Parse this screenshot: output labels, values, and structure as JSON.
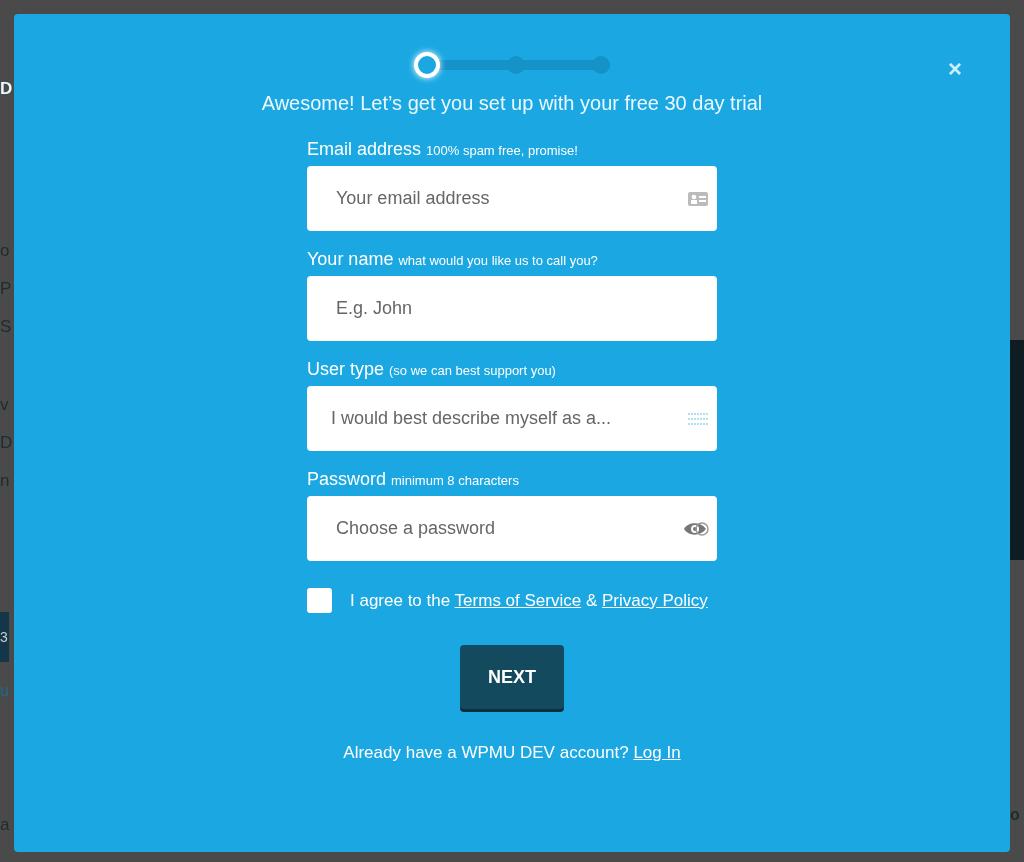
{
  "backdrop": {
    "left_fragments": [
      {
        "text": "D",
        "kind": "heading"
      },
      {
        "text": "o",
        "kind": "body"
      },
      {
        "text": "P",
        "kind": "body"
      },
      {
        "text": "S",
        "kind": "body"
      },
      {
        "text": "v",
        "kind": "body"
      },
      {
        "text": "D",
        "kind": "body"
      },
      {
        "text": "n",
        "kind": "body"
      },
      {
        "text": "3",
        "kind": "button"
      },
      {
        "text": "u",
        "kind": "link"
      },
      {
        "text": "a",
        "kind": "body"
      }
    ],
    "right_fragments": [
      {
        "text": "o",
        "kind": "heading"
      }
    ]
  },
  "stepper": {
    "steps": [
      {
        "selected": true
      },
      {
        "selected": false
      },
      {
        "selected": false
      }
    ]
  },
  "close": "×",
  "heading": "Awesome! Let’s get you set up with your free 30 day trial",
  "fields": [
    {
      "label": "Email address",
      "hint": "100% spam free, promise!",
      "placeholder": "Your email address",
      "kind": "email"
    },
    {
      "label": "Your name",
      "hint": "what would you like us to call you?",
      "placeholder": "E.g. John",
      "kind": "text"
    },
    {
      "label": "User type",
      "hint": "(so we can best support you)",
      "placeholder": "I would best describe myself as a...",
      "kind": "select"
    },
    {
      "label": "Password",
      "hint": "minimum 8 characters",
      "placeholder": "Choose a password",
      "kind": "password"
    }
  ],
  "agree": {
    "checked": false,
    "prefix": "I agree to the",
    "terms": "Terms of Service",
    "joiner": "&",
    "privacy": "Privacy Policy"
  },
  "next_button": "NEXT",
  "footer": {
    "text": "Already have a WPMU DEV account?",
    "link": "Log In"
  }
}
